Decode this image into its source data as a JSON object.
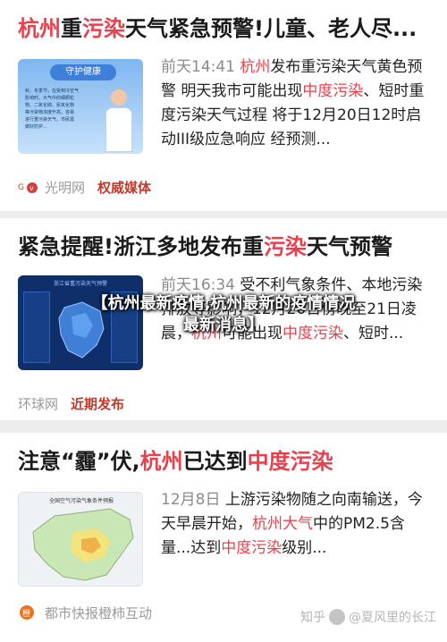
{
  "articles": [
    {
      "title_parts": [
        "杭州",
        "重",
        "污染",
        "天气紧急预警!儿童、老人尽..."
      ],
      "thumb": {
        "banner": "守护健康",
        "lines": [
          "秋、冬季节，在受到冷空气",
          "影响时，大气中的细颗粒",
          "物、二氧化硫、氮氧化物",
          "等污染物浓度升高，容易",
          "进行重污染天气，市民需",
          "做好防护..."
        ]
      },
      "time": "前天14:41",
      "snippet_parts": [
        "杭州",
        "发布重污染天气黄色预警 明天我市可能出现",
        "中度污染",
        "、短时重度污染天气过程 将于12月20日12时启动III级应急响应 经预测..."
      ],
      "source": "光明网",
      "tag": "权威媒体"
    },
    {
      "title_parts": [
        "紧急提醒!浙江多地发布重",
        "污染",
        "天气预警"
      ],
      "thumb": {
        "banner": "浙江省重污染天气预警",
        "lines": []
      },
      "time": "前天16:34",
      "snippet_parts": [
        "受不利气象条件、本地污染排放等影响，",
        "12月20日傍晚至21日凌晨，",
        "杭州",
        "可能出现",
        "中度污染",
        "、短时..."
      ],
      "source": "环球网",
      "tag": "近期发布"
    },
    {
      "title_parts": [
        "注意“霾”伏,",
        "杭州",
        "已达到",
        "中度污染"
      ],
      "thumb": {
        "banner": "全国空气污染气象条件预报",
        "lines": []
      },
      "time": "12月8日",
      "snippet_parts": [
        "上游污染物随之向南输送，今天早晨开始，",
        "杭州大气",
        "中的PM2.5含量...达到",
        "中度污染",
        "级别..."
      ],
      "source": "都市快报橙柿互动",
      "tag": ""
    }
  ],
  "overlay": {
    "line1": "【杭州最新疫情,杭州最新的疫情情况",
    "line2": "最新消息】"
  },
  "watermark": {
    "prefix": "知乎",
    "author": "@夏风里的长江"
  },
  "colors": {
    "highlight": "#e8414e",
    "tag": "#c0392b",
    "muted": "#8a8a8a"
  }
}
